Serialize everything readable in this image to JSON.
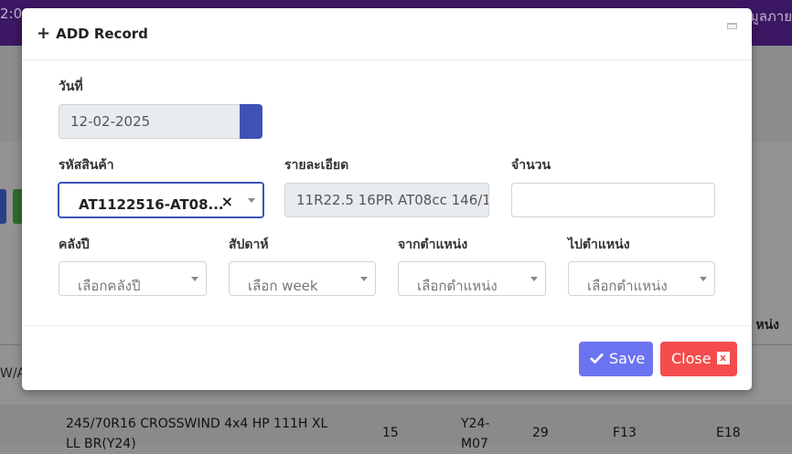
{
  "background": {
    "topbar_time": "2:0",
    "topbar_right": "ๆ มูลภาย",
    "column_header": "หน่ง",
    "wa_text": "W/A",
    "row": {
      "description": "245/70R16 CROSSWIND 4x4 HP 111H XL",
      "description_line2": "LL BR(Y24)",
      "qty": "15",
      "week": "Y24-",
      "week_line2": "M07",
      "num": "29",
      "from": "F13",
      "to": "E18"
    }
  },
  "modal": {
    "title_icon": "+",
    "title": "ADD Record",
    "date": {
      "label": "วันที่",
      "value": "12-02-2025"
    },
    "product_code": {
      "label": "รหัสสินค้า",
      "value": "AT1122516-AT08...",
      "clear": "×"
    },
    "detail": {
      "label": "รายละเอียด",
      "value": "11R22.5 16PR AT08cc 146/1"
    },
    "quantity": {
      "label": "จำนวน",
      "value": ""
    },
    "warehouse": {
      "label": "คลังปี",
      "placeholder": "เลือกคลังปี"
    },
    "week": {
      "label": "สัปดาห์",
      "placeholder": "เลือก week"
    },
    "from_location": {
      "label": "จากตำแหน่ง",
      "placeholder": "เลือกตำแหน่ง"
    },
    "to_location": {
      "label": "ไปตำแหน่ง",
      "placeholder": "เลือกตำแหน่ง"
    },
    "save_label": "Save",
    "close_label": "Close",
    "close_icon": "x"
  },
  "colors": {
    "primary": "#3f51b5",
    "save": "#6c73f0",
    "close": "#f44c4c",
    "topbar": "#3c1763"
  }
}
